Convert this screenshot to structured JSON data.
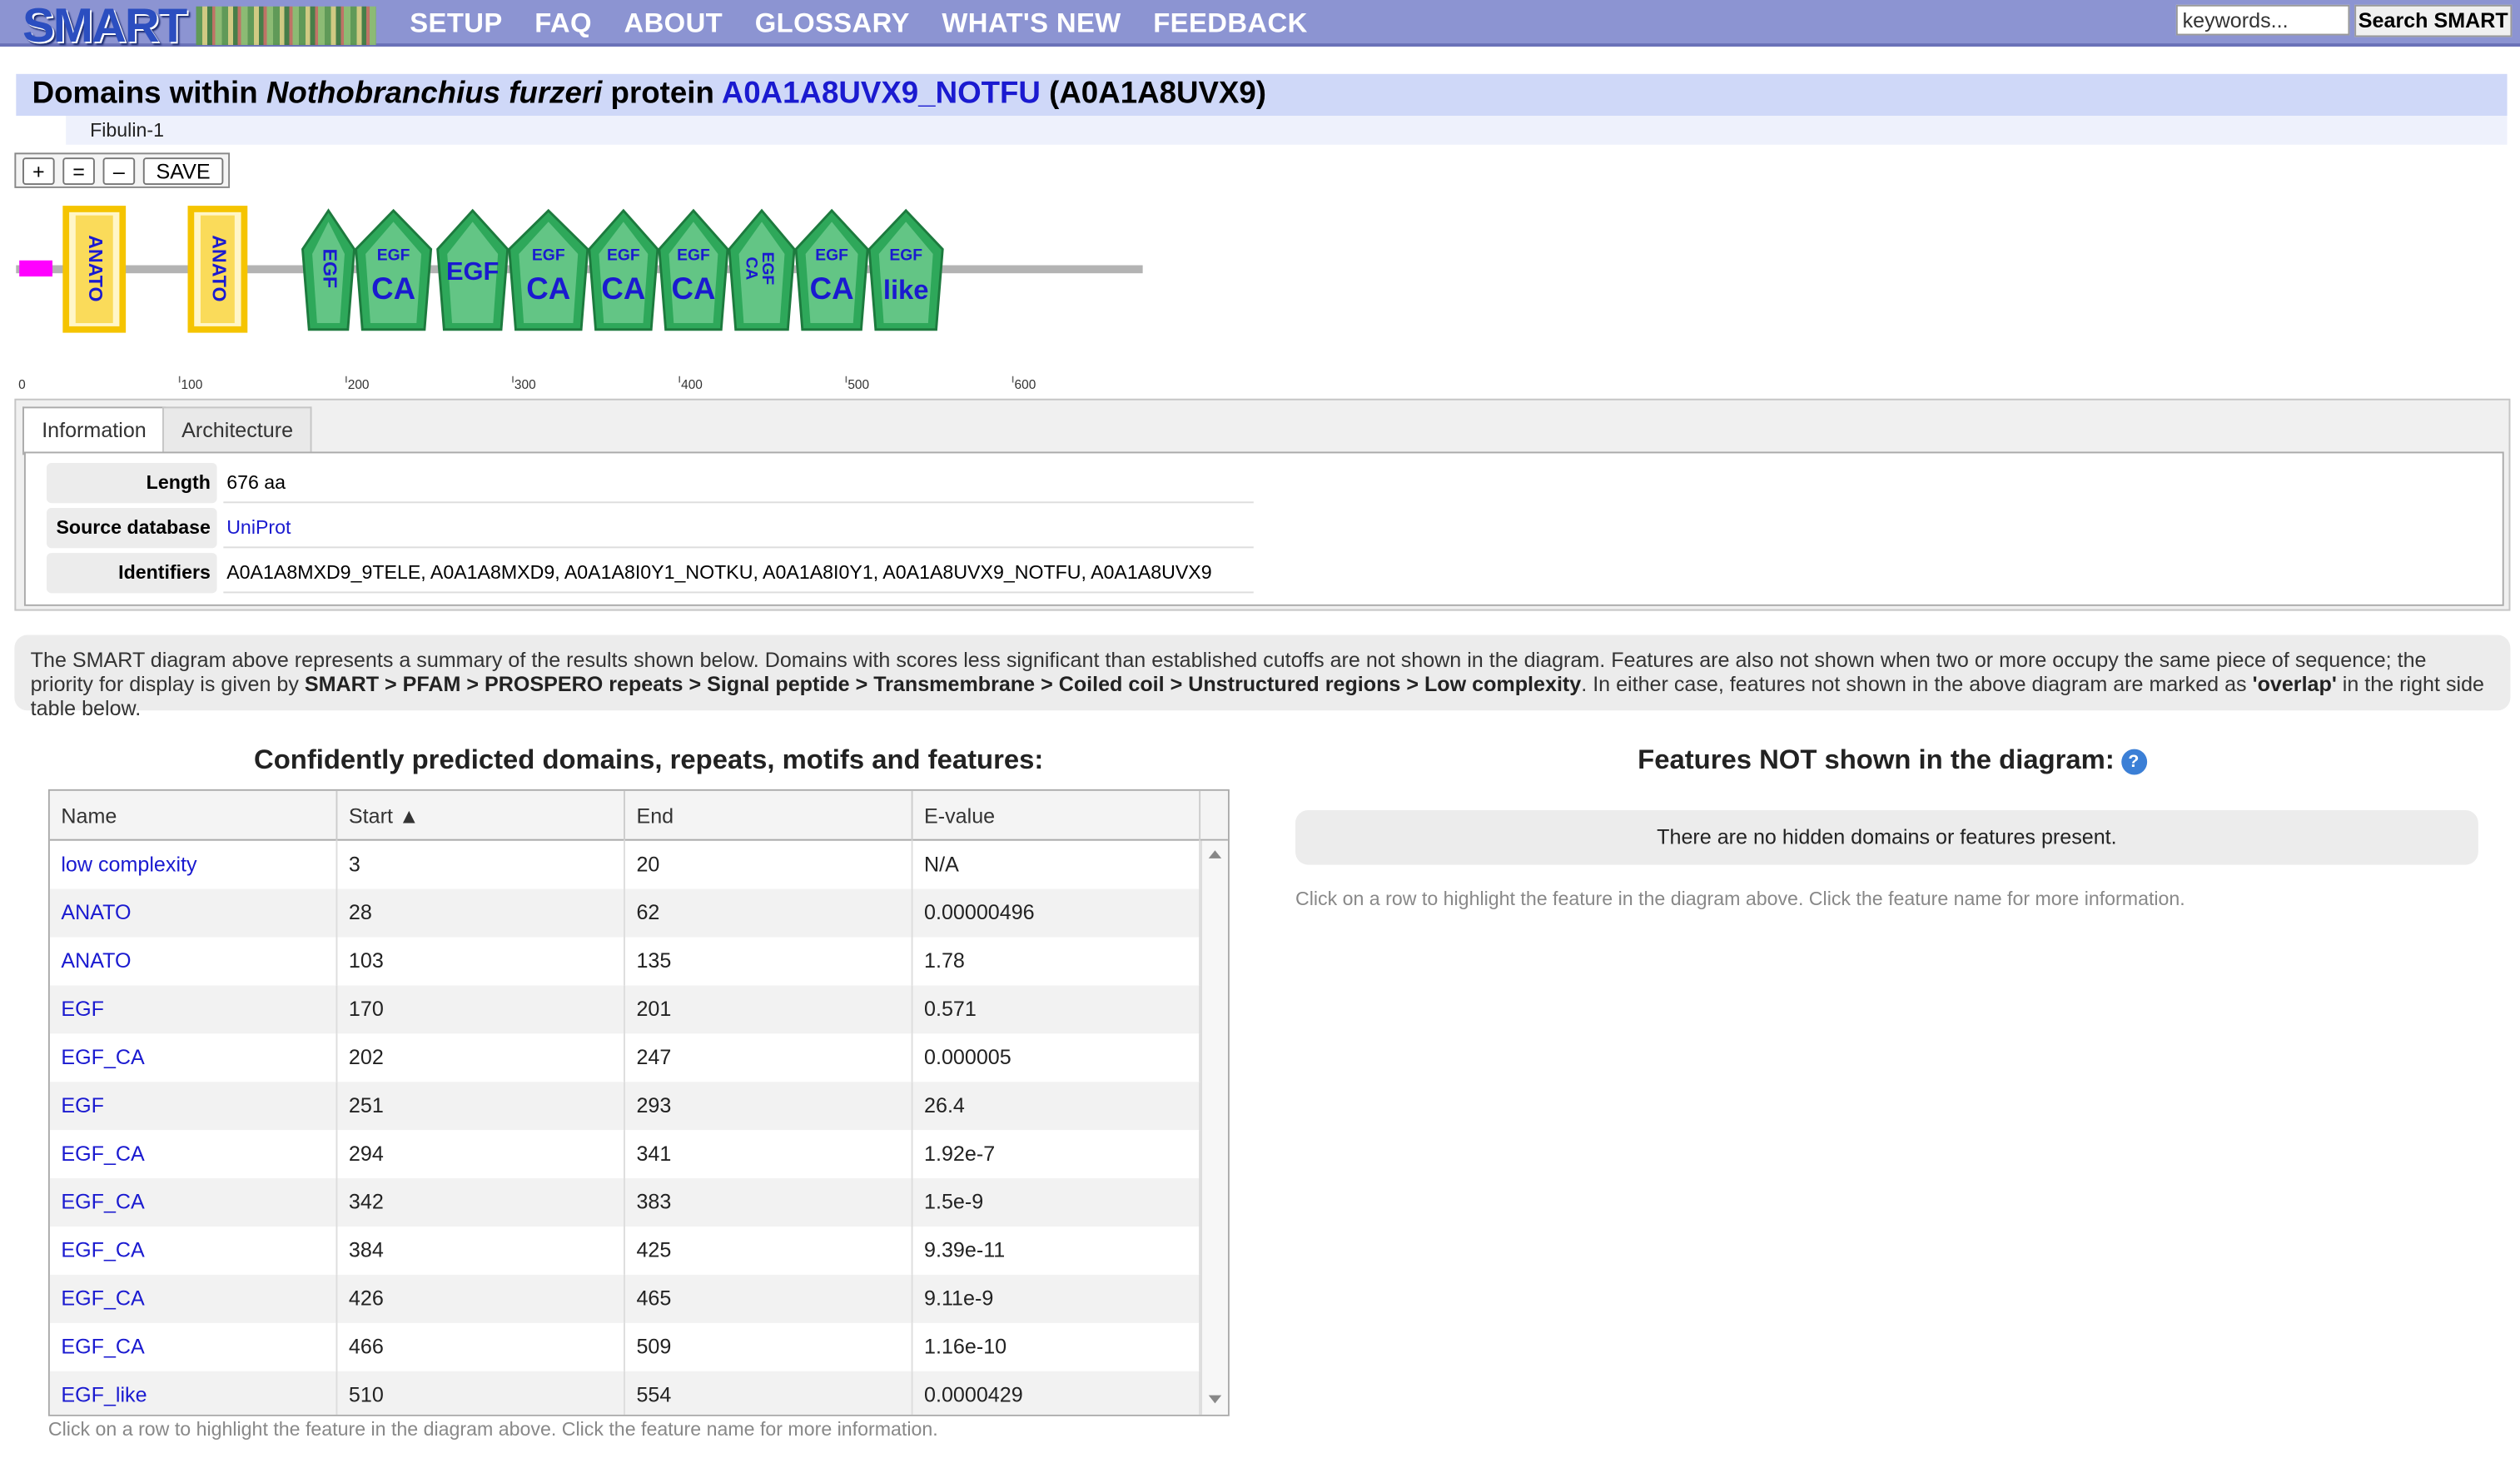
{
  "nav": {
    "logo_text": "SMART",
    "menu": [
      "SETUP",
      "FAQ",
      "ABOUT",
      "GLOSSARY",
      "WHAT'S NEW",
      "FEEDBACK"
    ],
    "search_placeholder": "keywords...",
    "search_button": "Search SMART"
  },
  "title": {
    "prefix": "Domains within ",
    "species": "Nothobranchius furzeri",
    "mid": " protein ",
    "entry_link": "A0A1A8UVX9_NOTFU",
    "accession": " (A0A1A8UVX9)"
  },
  "subtitle": "Fibulin-1",
  "zoom": {
    "plus": "+",
    "equal": "=",
    "minus": "–",
    "save": "SAVE"
  },
  "diagram": {
    "length": 676,
    "ticks": [
      0,
      100,
      200,
      300,
      400,
      500,
      600
    ],
    "lowcomplex": {
      "start": 3,
      "end": 20,
      "color": "#ff00ff"
    },
    "anato_color": "#f5c400",
    "egf_color": "#2ea85a",
    "domains": [
      {
        "type": "anato",
        "label": "ANATO",
        "start": 28,
        "end": 62
      },
      {
        "type": "anato",
        "label": "ANATO",
        "start": 103,
        "end": 135
      },
      {
        "type": "egf",
        "top": "EGF",
        "bottom": "",
        "vertical": true,
        "start": 170,
        "end": 201
      },
      {
        "type": "egf",
        "top": "EGF",
        "bottom": "CA",
        "start": 202,
        "end": 247
      },
      {
        "type": "egf",
        "top": "EGF",
        "bottom": "",
        "big": true,
        "start": 251,
        "end": 293
      },
      {
        "type": "egf",
        "top": "EGF",
        "bottom": "CA",
        "start": 294,
        "end": 341
      },
      {
        "type": "egf",
        "top": "EGF",
        "bottom": "CA",
        "start": 342,
        "end": 383
      },
      {
        "type": "egf",
        "top": "EGF",
        "bottom": "CA",
        "start": 384,
        "end": 425
      },
      {
        "type": "egf",
        "top": "EGF",
        "bottom": "CA",
        "vertical": true,
        "start": 426,
        "end": 465
      },
      {
        "type": "egf",
        "top": "EGF",
        "bottom": "CA",
        "start": 466,
        "end": 509
      },
      {
        "type": "egf",
        "top": "EGF",
        "bottom": "like",
        "start": 510,
        "end": 554
      }
    ]
  },
  "tabs": {
    "info": "Information",
    "arch": "Architecture"
  },
  "info": {
    "length_label": "Length",
    "length_value": "676 aa",
    "source_label": "Source database",
    "source_value": "UniProt",
    "ids_label": "Identifiers",
    "ids_value": "A0A1A8MXD9_9TELE, A0A1A8MXD9, A0A1A8I0Y1_NOTKU, A0A1A8I0Y1, A0A1A8UVX9_NOTFU, A0A1A8UVX9"
  },
  "notice": {
    "t1": "The SMART diagram above represents a summary of the results shown below. Domains with scores less significant than established cutoffs are not shown in the diagram. Features are also not shown when two or more occupy the same piece of sequence; the priority for display is given by ",
    "priority": "SMART > PFAM > PROSPERO repeats > Signal peptide > Transmembrane > Coiled coil > Unstructured regions > Low complexity",
    "t2": ". In either case, features not shown in the above diagram are marked as ",
    "overlap": "'overlap'",
    "t3": " in the right side table below."
  },
  "left_heading": "Confidently predicted domains, repeats, motifs and features:",
  "right_heading": "Features NOT shown in the diagram:",
  "help_icon": "?",
  "table": {
    "headers": [
      "Name",
      "Start ▲",
      "End",
      "E-value"
    ],
    "rows": [
      [
        "low complexity",
        "3",
        "20",
        "N/A"
      ],
      [
        "ANATO",
        "28",
        "62",
        "0.00000496"
      ],
      [
        "ANATO",
        "103",
        "135",
        "1.78"
      ],
      [
        "EGF",
        "170",
        "201",
        "0.571"
      ],
      [
        "EGF_CA",
        "202",
        "247",
        "0.000005"
      ],
      [
        "EGF",
        "251",
        "293",
        "26.4"
      ],
      [
        "EGF_CA",
        "294",
        "341",
        "1.92e-7"
      ],
      [
        "EGF_CA",
        "342",
        "383",
        "1.5e-9"
      ],
      [
        "EGF_CA",
        "384",
        "425",
        "9.39e-11"
      ],
      [
        "EGF_CA",
        "426",
        "465",
        "9.11e-9"
      ],
      [
        "EGF_CA",
        "466",
        "509",
        "1.16e-10"
      ],
      [
        "EGF_like",
        "510",
        "554",
        "0.0000429"
      ]
    ]
  },
  "hidden_message": "There are no hidden domains or features present.",
  "hint": "Click on a row to highlight the feature in the diagram above. Click the feature name for more information."
}
